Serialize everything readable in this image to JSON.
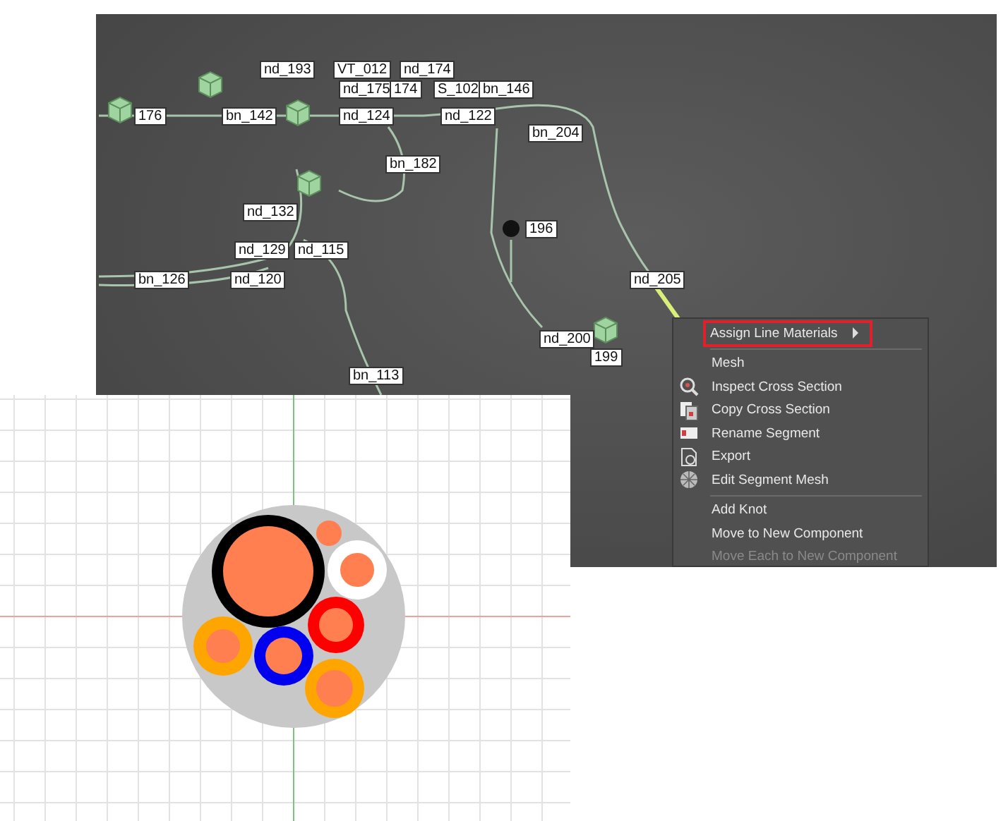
{
  "viewport_labels": [
    "nd_193",
    "VT_012",
    "nd_174",
    "nd_175",
    "174",
    "S_102",
    "bn_146",
    "176",
    "bn_142",
    "nd_124",
    "nd_122",
    "bn_204",
    "bn_182",
    "nd_132",
    "196",
    "nd_129",
    "nd_115",
    "bn_126",
    "nd_120",
    "nd_205",
    "nd_200",
    "199",
    "bn_113"
  ],
  "context_menu": {
    "items": [
      {
        "kind": "item",
        "label": "Assign Line Materials",
        "has_submenu": true,
        "disabled": false,
        "highlighted": true
      },
      {
        "kind": "separator"
      },
      {
        "kind": "item",
        "label": "Mesh",
        "has_submenu": false,
        "disabled": false,
        "highlighted": false
      },
      {
        "kind": "item",
        "label": "Inspect Cross Section",
        "has_submenu": false,
        "disabled": false,
        "highlighted": false
      },
      {
        "kind": "item",
        "label": "Copy Cross Section",
        "has_submenu": false,
        "disabled": false,
        "highlighted": false
      },
      {
        "kind": "item",
        "label": "Rename Segment",
        "has_submenu": false,
        "disabled": false,
        "highlighted": false
      },
      {
        "kind": "item",
        "label": "Export",
        "has_submenu": false,
        "disabled": false,
        "highlighted": false
      },
      {
        "kind": "item",
        "label": "Edit Segment Mesh",
        "has_submenu": false,
        "disabled": false,
        "highlighted": false
      },
      {
        "kind": "separator"
      },
      {
        "kind": "item",
        "label": "Add Knot",
        "has_submenu": false,
        "disabled": false,
        "highlighted": false
      },
      {
        "kind": "item",
        "label": "Move to New Component",
        "has_submenu": false,
        "disabled": false,
        "highlighted": false
      },
      {
        "kind": "item",
        "label": "Move Each to New Component",
        "has_submenu": false,
        "disabled": true,
        "highlighted": false
      }
    ]
  }
}
